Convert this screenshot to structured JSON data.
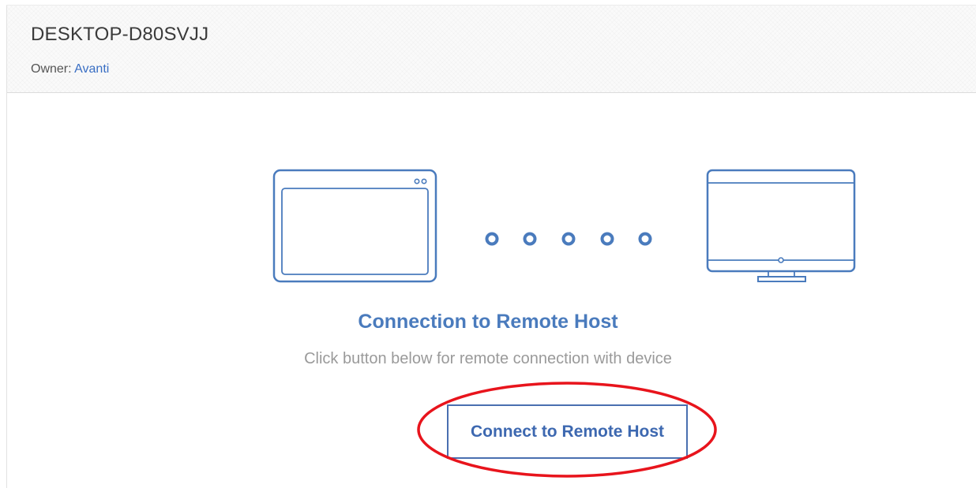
{
  "header": {
    "device_name": "DESKTOP-D80SVJJ",
    "owner_label": "Owner:",
    "owner_name": "Avanti"
  },
  "illustration": {
    "left_device_icon": "tablet-icon",
    "right_device_icon": "monitor-icon",
    "connector_icon": "connection-dots-icon",
    "dot_count": 5
  },
  "connection": {
    "title": "Connection to Remote Host",
    "subtitle": "Click button below for remote connection with device",
    "button_label": "Connect to Remote Host"
  },
  "colors": {
    "accent": "#4a7bbd",
    "button_border": "#4a6fb0",
    "highlight_ellipse": "#e8141c",
    "link": "#3a6fc4"
  }
}
